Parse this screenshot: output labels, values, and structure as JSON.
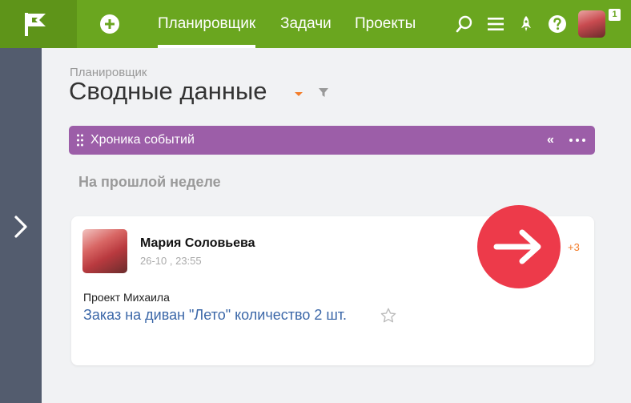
{
  "topbar": {
    "tabs": [
      {
        "label": "Планировщик",
        "active": true
      },
      {
        "label": "Задачи",
        "active": false
      },
      {
        "label": "Проекты",
        "active": false
      }
    ],
    "icons": [
      "search-icon",
      "menu-icon",
      "rocket-icon",
      "help-icon"
    ],
    "notification_count": "1",
    "accent_color": "#6aa61f"
  },
  "page": {
    "breadcrumb": "Планировщик",
    "title": "Сводные данные"
  },
  "timeline": {
    "title": "Хроника событий",
    "collapse_symbol": "«",
    "bar_color": "#9c5ea8"
  },
  "feed": {
    "section_label": "На прошлой неделе",
    "items": [
      {
        "author": "Мария Соловьева",
        "datetime": "26-10 , 23:55",
        "plus_count": "+3",
        "project": "Проект Михаила",
        "task": "Заказ на диван \"Лето\" количество 2 шт."
      }
    ]
  }
}
